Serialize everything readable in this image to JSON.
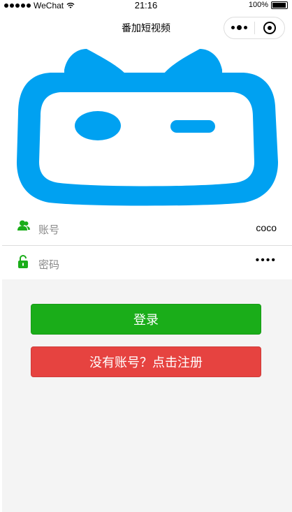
{
  "status_bar": {
    "carrier": "WeChat",
    "time": "21:16",
    "battery": "100%"
  },
  "nav": {
    "title": "番加短视频"
  },
  "logo": {
    "icon": "bilibili-tv-logo",
    "color": "#00a1f1"
  },
  "form": {
    "username": {
      "label": "账号",
      "value": "coco",
      "icon": "user-icon"
    },
    "password": {
      "label": "密码",
      "value": "••••",
      "icon": "lock-icon"
    }
  },
  "buttons": {
    "login": "登录",
    "register": "没有账号？点击注册"
  },
  "colors": {
    "login_bg": "#1aad19",
    "register_bg": "#e64340",
    "icon_green": "#1aad19",
    "page_bg": "#f4f4f4"
  }
}
